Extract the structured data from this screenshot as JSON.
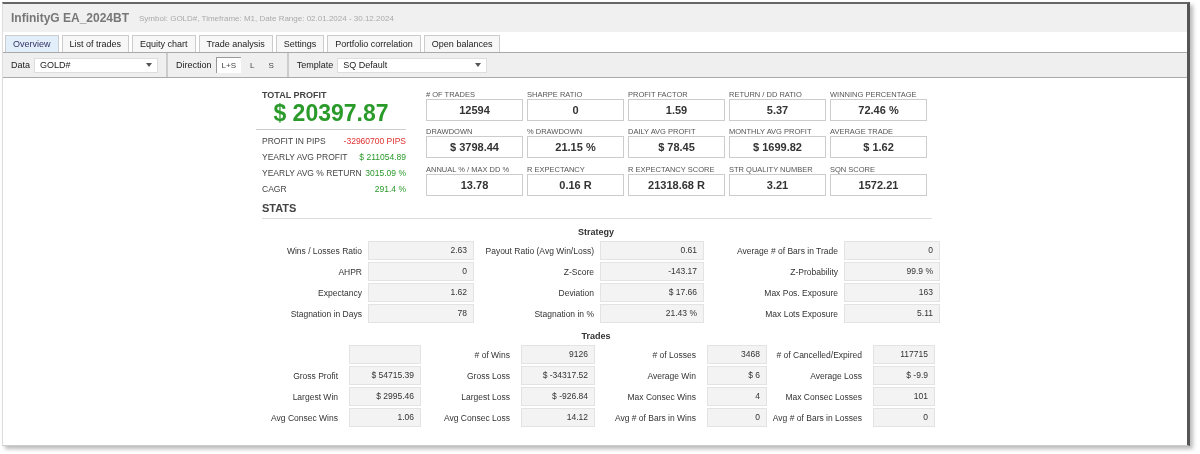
{
  "window": {
    "title": "InfinityG EA_2024BT",
    "subtitle": "Symbol: GOLD#, Timeframe: M1, Date Range: 02.01.2024 - 30.12.2024"
  },
  "tabs": [
    {
      "label": "Overview",
      "selected": true
    },
    {
      "label": "List of trades",
      "selected": false
    },
    {
      "label": "Equity chart",
      "selected": false
    },
    {
      "label": "Trade analysis",
      "selected": false
    },
    {
      "label": "Settings",
      "selected": false
    },
    {
      "label": "Portfolio correlation",
      "selected": false
    },
    {
      "label": "Open balances",
      "selected": false
    }
  ],
  "toolbar": {
    "data": {
      "label": "Data",
      "value": "GOLD#"
    },
    "direction": {
      "label": "Direction",
      "options": [
        {
          "label": "L+S",
          "selected": true
        },
        {
          "label": "L",
          "selected": false
        },
        {
          "label": "S",
          "selected": false
        }
      ]
    },
    "template": {
      "label": "Template",
      "value": "SQ Default"
    }
  },
  "summary": {
    "total_profit": {
      "label": "TOTAL PROFIT",
      "value": "$ 20397.87"
    },
    "rows": [
      {
        "label": "PROFIT IN PIPS",
        "value": "-32960700 PIPS",
        "kind": "negative"
      },
      {
        "label": "YEARLY AVG PROFIT",
        "value": "$ 211054.89",
        "kind": "positive"
      },
      {
        "label": "YEARLY AVG % RETURN",
        "value": "3015.09 %",
        "kind": "positive"
      },
      {
        "label": "CAGR",
        "value": "291.4 %",
        "kind": "positive"
      }
    ]
  },
  "metrics": [
    {
      "label": "# OF TRADES",
      "value": "12594"
    },
    {
      "label": "SHARPE RATIO",
      "value": "0"
    },
    {
      "label": "PROFIT FACTOR",
      "value": "1.59"
    },
    {
      "label": "RETURN / DD RATIO",
      "value": "5.37"
    },
    {
      "label": "WINNING PERCENTAGE",
      "value": "72.46 %"
    },
    {
      "label": "DRAWDOWN",
      "value": "$ 3798.44"
    },
    {
      "label": "% DRAWDOWN",
      "value": "21.15 %"
    },
    {
      "label": "DAILY AVG PROFIT",
      "value": "$ 78.45"
    },
    {
      "label": "MONTHLY AVG PROFIT",
      "value": "$ 1699.82"
    },
    {
      "label": "AVERAGE TRADE",
      "value": "$ 1.62"
    },
    {
      "label": "ANNUAL % / MAX DD %",
      "value": "13.78"
    },
    {
      "label": "R EXPECTANCY",
      "value": "0.16 R"
    },
    {
      "label": "R EXPECTANCY SCORE",
      "value": "21318.68 R"
    },
    {
      "label": "STR QUALITY NUMBER",
      "value": "3.21"
    },
    {
      "label": "SQN SCORE",
      "value": "1572.21"
    }
  ],
  "stats": {
    "title": "STATS",
    "strategy": {
      "title": "Strategy",
      "cells": [
        {
          "label": "Wins / Losses Ratio",
          "value": "2.63"
        },
        {
          "label": "Payout Ratio (Avg Win/Loss)",
          "value": "0.61"
        },
        {
          "label": "Average # of Bars in Trade",
          "value": "0"
        },
        {
          "label": "AHPR",
          "value": "0"
        },
        {
          "label": "Z-Score",
          "value": "-143.17"
        },
        {
          "label": "Z-Probability",
          "value": "99.9 %"
        },
        {
          "label": "Expectancy",
          "value": "1.62"
        },
        {
          "label": "Deviation",
          "value": "$ 17.66"
        },
        {
          "label": "Max Pos. Exposure",
          "value": "163"
        },
        {
          "label": "Stagnation in Days",
          "value": "78"
        },
        {
          "label": "Stagnation in %",
          "value": "21.43 %"
        },
        {
          "label": "Max Lots Exposure",
          "value": "5.11"
        }
      ]
    },
    "trades": {
      "title": "Trades",
      "cells": [
        {
          "kind": "empty"
        },
        {
          "kind": "stat",
          "label": "# of Wins",
          "value": "9126"
        },
        {
          "kind": "stat",
          "label": "# of Losses",
          "value": "3468"
        },
        {
          "kind": "stat",
          "label": "# of Cancelled/Expired",
          "value": "117715"
        },
        {
          "kind": "stat",
          "label": "Gross Profit",
          "value": "$ 54715.39"
        },
        {
          "kind": "stat",
          "label": "Gross Loss",
          "value": "$ -34317.52"
        },
        {
          "kind": "stat",
          "label": "Average Win",
          "value": "$ 6"
        },
        {
          "kind": "stat",
          "label": "Average Loss",
          "value": "$ -9.9"
        },
        {
          "kind": "stat",
          "label": "Largest Win",
          "value": "$ 2995.46"
        },
        {
          "kind": "stat",
          "label": "Largest Loss",
          "value": "$ -926.84"
        },
        {
          "kind": "stat",
          "label": "Max Consec Wins",
          "value": "4"
        },
        {
          "kind": "stat",
          "label": "Max Consec Losses",
          "value": "101"
        },
        {
          "kind": "stat",
          "label": "Avg Consec Wins",
          "value": "1.06"
        },
        {
          "kind": "stat",
          "label": "Avg Consec Loss",
          "value": "14.12"
        },
        {
          "kind": "stat",
          "label": "Avg # of Bars in Wins",
          "value": "0"
        },
        {
          "kind": "stat",
          "label": "Avg # of Bars in Losses",
          "value": "0"
        }
      ]
    }
  }
}
